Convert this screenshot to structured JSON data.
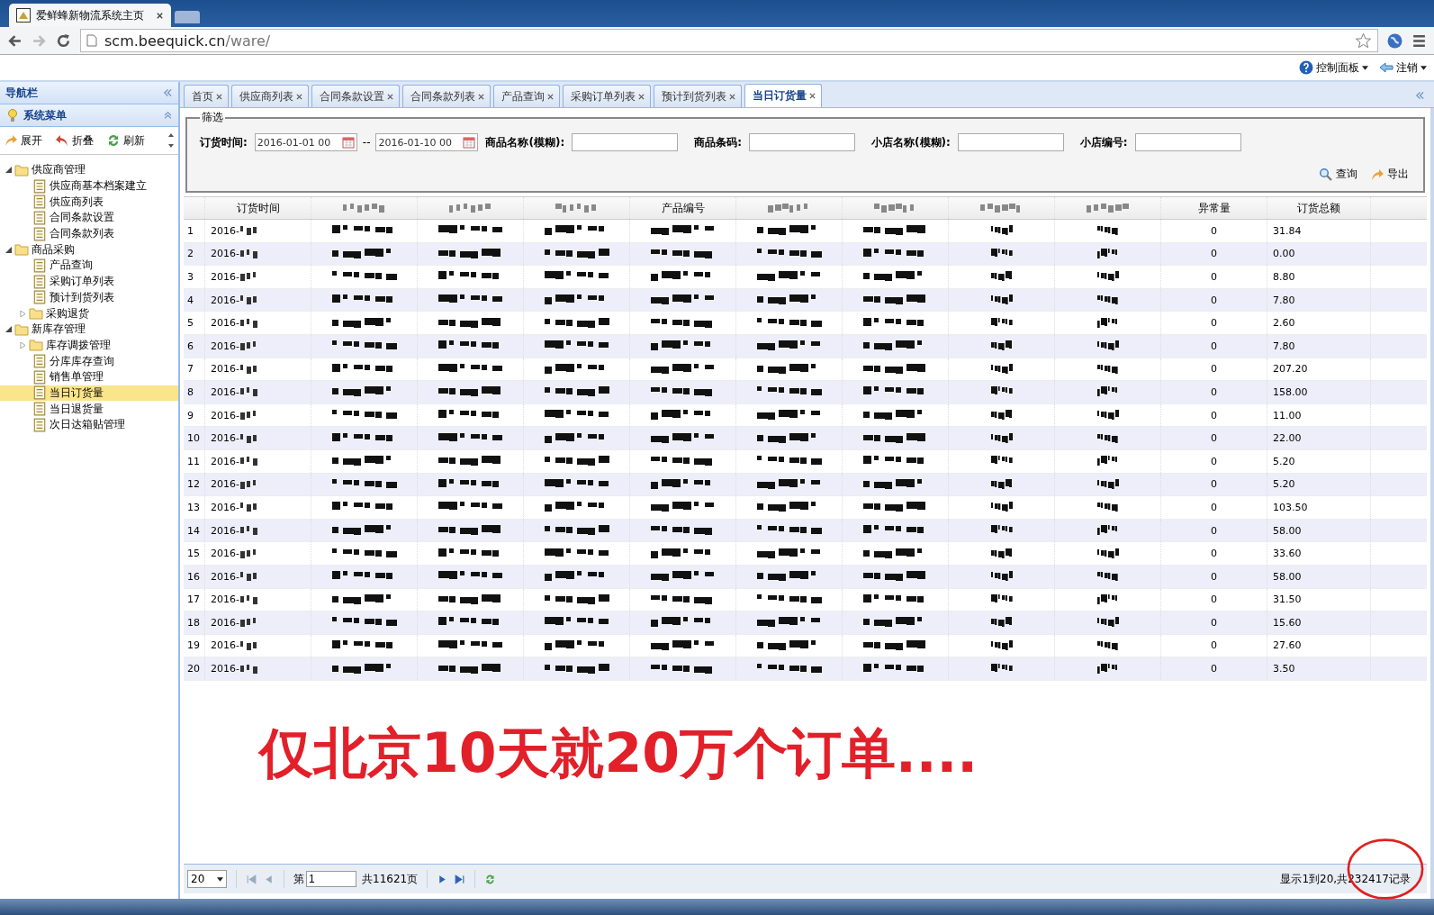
{
  "browser": {
    "tab_title": "爱鲜蜂新物流系统主页",
    "url_host": "scm.beequick.cn",
    "url_path": "/ware/"
  },
  "header": {
    "menus": [
      {
        "label": "控制面板",
        "kind": "help"
      },
      {
        "label": "注销",
        "kind": "logout"
      }
    ]
  },
  "sidebar": {
    "title": "导航栏",
    "section": "系统菜单",
    "tools": [
      {
        "label": "展开",
        "kind": "expand"
      },
      {
        "label": "折叠",
        "kind": "collapse"
      },
      {
        "label": "刷新",
        "kind": "refresh"
      }
    ],
    "tree": [
      {
        "label": "供应商管理",
        "kind": "folder",
        "expanded": true,
        "children": [
          {
            "label": "供应商基本档案建立",
            "selected": false
          },
          {
            "label": "供应商列表",
            "selected": false
          },
          {
            "label": "合同条款设置",
            "selected": false
          },
          {
            "label": "合同条款列表",
            "selected": false
          }
        ]
      },
      {
        "label": "商品采购",
        "kind": "folder",
        "expanded": true,
        "children": [
          {
            "label": "产品查询",
            "selected": false
          },
          {
            "label": "采购订单列表",
            "selected": false
          },
          {
            "label": "预计到货列表",
            "selected": false
          },
          {
            "label": "采购退货",
            "kind": "folder",
            "expanded": false
          }
        ]
      },
      {
        "label": "新库存管理",
        "kind": "folder",
        "expanded": true,
        "children": [
          {
            "label": "库存调拨管理",
            "kind": "folder",
            "expanded": false
          },
          {
            "label": "分库库存查询",
            "selected": false
          },
          {
            "label": "销售单管理",
            "selected": false
          },
          {
            "label": "当日订货量",
            "selected": true
          },
          {
            "label": "当日退货量",
            "selected": false
          },
          {
            "label": "次日达箱贴管理",
            "selected": false
          }
        ]
      }
    ]
  },
  "tabs": [
    {
      "label": "首页",
      "selected": false
    },
    {
      "label": "供应商列表",
      "selected": false
    },
    {
      "label": "合同条款设置",
      "selected": false
    },
    {
      "label": "合同条款列表",
      "selected": false
    },
    {
      "label": "产品查询",
      "selected": false
    },
    {
      "label": "采购订单列表",
      "selected": false
    },
    {
      "label": "预计到货列表",
      "selected": false
    },
    {
      "label": "当日订货量",
      "selected": true
    }
  ],
  "filter": {
    "legend": "筛选",
    "fields": [
      {
        "label": "订货时间:",
        "kind": "date_range",
        "from": "2016-01-01 00",
        "separator": "--",
        "to": "2016-01-10 00"
      },
      {
        "label": "商品名称(模糊):",
        "kind": "text"
      },
      {
        "label": "商品条码:",
        "kind": "text"
      },
      {
        "label": "小店名称(模糊):",
        "kind": "text"
      },
      {
        "label": "小店编号:",
        "kind": "text"
      }
    ],
    "buttons": [
      {
        "label": "查询",
        "kind": "search"
      },
      {
        "label": "导出",
        "kind": "export"
      }
    ]
  },
  "table": {
    "columns": [
      {
        "label": "订货时间"
      },
      {
        "kind": "pixelated"
      },
      {
        "kind": "pixelated"
      },
      {
        "kind": "pixelated"
      },
      {
        "label": "产品编号"
      },
      {
        "kind": "pixelated"
      },
      {
        "kind": "pixelated"
      },
      {
        "kind": "pixelated"
      },
      {
        "kind": "pixelated"
      },
      {
        "label": "异常量"
      },
      {
        "label": "订货总额"
      }
    ],
    "rows": [
      {
        "no": "1",
        "date": "2016-",
        "abnormal": "0",
        "amount": "31.84"
      },
      {
        "no": "2",
        "date": "2016-",
        "abnormal": "0",
        "amount": "0.00"
      },
      {
        "no": "3",
        "date": "2016-",
        "abnormal": "0",
        "amount": "8.80"
      },
      {
        "no": "4",
        "date": "2016-",
        "abnormal": "0",
        "amount": "7.80"
      },
      {
        "no": "5",
        "date": "2016-",
        "abnormal": "0",
        "amount": "2.60"
      },
      {
        "no": "6",
        "date": "2016-",
        "abnormal": "0",
        "amount": "7.80"
      },
      {
        "no": "7",
        "date": "2016-",
        "abnormal": "0",
        "amount": "207.20"
      },
      {
        "no": "8",
        "date": "2016-",
        "abnormal": "0",
        "amount": "158.00"
      },
      {
        "no": "9",
        "date": "2016-",
        "abnormal": "0",
        "amount": "11.00"
      },
      {
        "no": "10",
        "date": "2016-",
        "abnormal": "0",
        "amount": "22.00"
      },
      {
        "no": "11",
        "date": "2016-",
        "abnormal": "0",
        "amount": "5.20"
      },
      {
        "no": "12",
        "date": "2016-",
        "abnormal": "0",
        "amount": "5.20"
      },
      {
        "no": "13",
        "date": "2016-",
        "abnormal": "0",
        "amount": "103.50"
      },
      {
        "no": "14",
        "date": "2016-",
        "abnormal": "0",
        "amount": "58.00"
      },
      {
        "no": "15",
        "date": "2016-",
        "abnormal": "0",
        "amount": "33.60"
      },
      {
        "no": "16",
        "date": "2016-",
        "abnormal": "0",
        "amount": "58.00"
      },
      {
        "no": "17",
        "date": "2016-",
        "abnormal": "0",
        "amount": "31.50"
      },
      {
        "no": "18",
        "date": "2016-",
        "abnormal": "0",
        "amount": "15.60"
      },
      {
        "no": "19",
        "date": "2016-",
        "abnormal": "0",
        "amount": "27.60"
      },
      {
        "no": "20",
        "date": "2016-",
        "abnormal": "0",
        "amount": "3.50"
      }
    ]
  },
  "annotation": "仅北京10天就20万个订单....",
  "pager": {
    "page_size": "20",
    "page_prefix": "第",
    "page": "1",
    "page_total": "共11621页",
    "status": "显示1到20,共232417记录"
  }
}
